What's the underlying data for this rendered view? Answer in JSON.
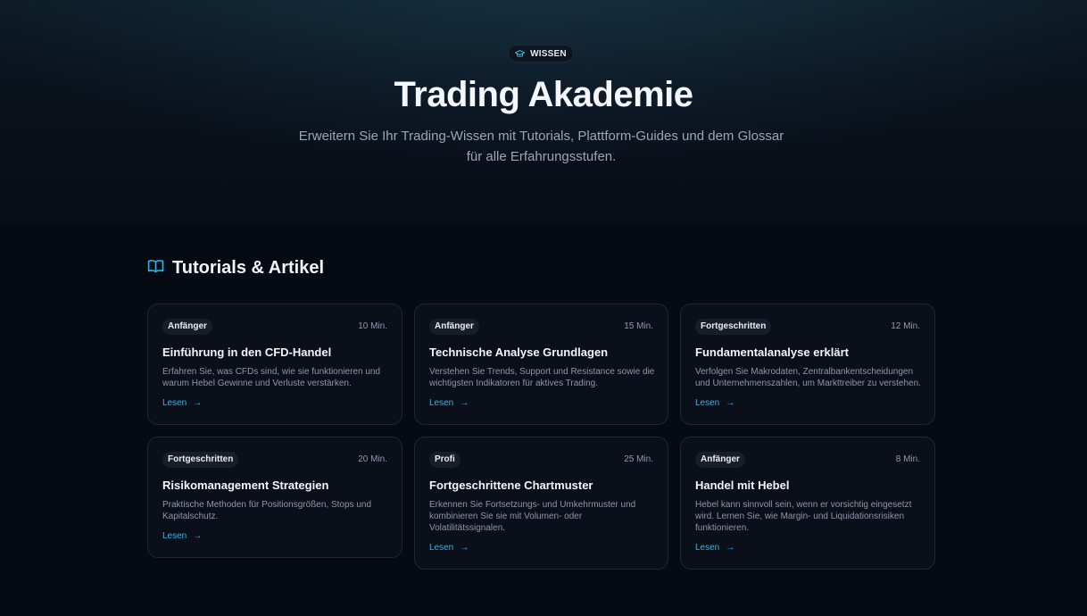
{
  "hero": {
    "badge_icon": "graduation-cap-icon",
    "badge_label": "WISSEN",
    "title": "Trading Akademie",
    "subtitle": "Erweitern Sie Ihr Trading-Wissen mit Tutorials, Plattform-Guides und dem Glossar für alle Erfahrungsstufen."
  },
  "section": {
    "icon": "open-book-icon",
    "title": "Tutorials & Artikel"
  },
  "colors": {
    "accent": "#33b6e6",
    "background": "#060a13",
    "card_background": "#0a0f1a"
  },
  "cards": [
    {
      "level": "Anfänger",
      "duration": "10 Min.",
      "title": "Einführung in den CFD-Handel",
      "description": "Erfahren Sie, was CFDs sind, wie sie funktionieren und warum Hebel Gewinne und Verluste verstärken.",
      "link": "Lesen"
    },
    {
      "level": "Anfänger",
      "duration": "15 Min.",
      "title": "Technische Analyse Grundlagen",
      "description": "Verstehen Sie Trends, Support und Resistance sowie die wichtigsten Indikatoren für aktives Trading.",
      "link": "Lesen"
    },
    {
      "level": "Fortgeschritten",
      "duration": "12 Min.",
      "title": "Fundamentalanalyse erklärt",
      "description": "Verfolgen Sie Makrodaten, Zentralbankentscheidungen und Unternehmenszahlen, um Markttreiber zu verstehen.",
      "link": "Lesen"
    },
    {
      "level": "Fortgeschritten",
      "duration": "20 Min.",
      "title": "Risikomanagement Strategien",
      "description": "Praktische Methoden für Positionsgrößen, Stops und Kapitalschutz.",
      "link": "Lesen"
    },
    {
      "level": "Profi",
      "duration": "25 Min.",
      "title": "Fortgeschrittene Chartmuster",
      "description": "Erkennen Sie Fortsetzungs- und Umkehrmuster und kombinieren Sie sie mit Volumen- oder Volatilitätssignalen.",
      "link": "Lesen"
    },
    {
      "level": "Anfänger",
      "duration": "8 Min.",
      "title": "Handel mit Hebel",
      "description": "Hebel kann sinnvoll sein, wenn er vorsichtig eingesetzt wird. Lernen Sie, wie Margin- und Liquidationsrisiken funktionieren.",
      "link": "Lesen"
    }
  ]
}
